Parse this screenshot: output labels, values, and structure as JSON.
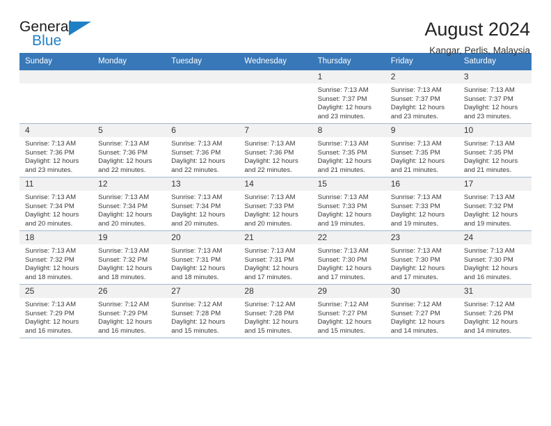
{
  "brand": {
    "name_top": "General",
    "name_bottom": "Blue",
    "flag_icon": "triangle-flag-icon"
  },
  "header": {
    "title": "August 2024",
    "location": "Kangar, Perlis, Malaysia"
  },
  "colors": {
    "header_blue": "#3878b8",
    "brand_blue": "#1f7fc4",
    "daynum_bg": "#f1f1f1",
    "grid_line": "#9fb8d0"
  },
  "weekday_headers": [
    "Sunday",
    "Monday",
    "Tuesday",
    "Wednesday",
    "Thursday",
    "Friday",
    "Saturday"
  ],
  "weeks": [
    [
      {
        "day": "",
        "blank": true
      },
      {
        "day": "",
        "blank": true
      },
      {
        "day": "",
        "blank": true
      },
      {
        "day": "",
        "blank": true
      },
      {
        "day": "1",
        "sunrise": "Sunrise: 7:13 AM",
        "sunset": "Sunset: 7:37 PM",
        "daylight_line1": "Daylight: 12 hours",
        "daylight_line2": "and 23 minutes."
      },
      {
        "day": "2",
        "sunrise": "Sunrise: 7:13 AM",
        "sunset": "Sunset: 7:37 PM",
        "daylight_line1": "Daylight: 12 hours",
        "daylight_line2": "and 23 minutes."
      },
      {
        "day": "3",
        "sunrise": "Sunrise: 7:13 AM",
        "sunset": "Sunset: 7:37 PM",
        "daylight_line1": "Daylight: 12 hours",
        "daylight_line2": "and 23 minutes."
      }
    ],
    [
      {
        "day": "4",
        "sunrise": "Sunrise: 7:13 AM",
        "sunset": "Sunset: 7:36 PM",
        "daylight_line1": "Daylight: 12 hours",
        "daylight_line2": "and 23 minutes."
      },
      {
        "day": "5",
        "sunrise": "Sunrise: 7:13 AM",
        "sunset": "Sunset: 7:36 PM",
        "daylight_line1": "Daylight: 12 hours",
        "daylight_line2": "and 22 minutes."
      },
      {
        "day": "6",
        "sunrise": "Sunrise: 7:13 AM",
        "sunset": "Sunset: 7:36 PM",
        "daylight_line1": "Daylight: 12 hours",
        "daylight_line2": "and 22 minutes."
      },
      {
        "day": "7",
        "sunrise": "Sunrise: 7:13 AM",
        "sunset": "Sunset: 7:36 PM",
        "daylight_line1": "Daylight: 12 hours",
        "daylight_line2": "and 22 minutes."
      },
      {
        "day": "8",
        "sunrise": "Sunrise: 7:13 AM",
        "sunset": "Sunset: 7:35 PM",
        "daylight_line1": "Daylight: 12 hours",
        "daylight_line2": "and 21 minutes."
      },
      {
        "day": "9",
        "sunrise": "Sunrise: 7:13 AM",
        "sunset": "Sunset: 7:35 PM",
        "daylight_line1": "Daylight: 12 hours",
        "daylight_line2": "and 21 minutes."
      },
      {
        "day": "10",
        "sunrise": "Sunrise: 7:13 AM",
        "sunset": "Sunset: 7:35 PM",
        "daylight_line1": "Daylight: 12 hours",
        "daylight_line2": "and 21 minutes."
      }
    ],
    [
      {
        "day": "11",
        "sunrise": "Sunrise: 7:13 AM",
        "sunset": "Sunset: 7:34 PM",
        "daylight_line1": "Daylight: 12 hours",
        "daylight_line2": "and 20 minutes."
      },
      {
        "day": "12",
        "sunrise": "Sunrise: 7:13 AM",
        "sunset": "Sunset: 7:34 PM",
        "daylight_line1": "Daylight: 12 hours",
        "daylight_line2": "and 20 minutes."
      },
      {
        "day": "13",
        "sunrise": "Sunrise: 7:13 AM",
        "sunset": "Sunset: 7:34 PM",
        "daylight_line1": "Daylight: 12 hours",
        "daylight_line2": "and 20 minutes."
      },
      {
        "day": "14",
        "sunrise": "Sunrise: 7:13 AM",
        "sunset": "Sunset: 7:33 PM",
        "daylight_line1": "Daylight: 12 hours",
        "daylight_line2": "and 20 minutes."
      },
      {
        "day": "15",
        "sunrise": "Sunrise: 7:13 AM",
        "sunset": "Sunset: 7:33 PM",
        "daylight_line1": "Daylight: 12 hours",
        "daylight_line2": "and 19 minutes."
      },
      {
        "day": "16",
        "sunrise": "Sunrise: 7:13 AM",
        "sunset": "Sunset: 7:33 PM",
        "daylight_line1": "Daylight: 12 hours",
        "daylight_line2": "and 19 minutes."
      },
      {
        "day": "17",
        "sunrise": "Sunrise: 7:13 AM",
        "sunset": "Sunset: 7:32 PM",
        "daylight_line1": "Daylight: 12 hours",
        "daylight_line2": "and 19 minutes."
      }
    ],
    [
      {
        "day": "18",
        "sunrise": "Sunrise: 7:13 AM",
        "sunset": "Sunset: 7:32 PM",
        "daylight_line1": "Daylight: 12 hours",
        "daylight_line2": "and 18 minutes."
      },
      {
        "day": "19",
        "sunrise": "Sunrise: 7:13 AM",
        "sunset": "Sunset: 7:32 PM",
        "daylight_line1": "Daylight: 12 hours",
        "daylight_line2": "and 18 minutes."
      },
      {
        "day": "20",
        "sunrise": "Sunrise: 7:13 AM",
        "sunset": "Sunset: 7:31 PM",
        "daylight_line1": "Daylight: 12 hours",
        "daylight_line2": "and 18 minutes."
      },
      {
        "day": "21",
        "sunrise": "Sunrise: 7:13 AM",
        "sunset": "Sunset: 7:31 PM",
        "daylight_line1": "Daylight: 12 hours",
        "daylight_line2": "and 17 minutes."
      },
      {
        "day": "22",
        "sunrise": "Sunrise: 7:13 AM",
        "sunset": "Sunset: 7:30 PM",
        "daylight_line1": "Daylight: 12 hours",
        "daylight_line2": "and 17 minutes."
      },
      {
        "day": "23",
        "sunrise": "Sunrise: 7:13 AM",
        "sunset": "Sunset: 7:30 PM",
        "daylight_line1": "Daylight: 12 hours",
        "daylight_line2": "and 17 minutes."
      },
      {
        "day": "24",
        "sunrise": "Sunrise: 7:13 AM",
        "sunset": "Sunset: 7:30 PM",
        "daylight_line1": "Daylight: 12 hours",
        "daylight_line2": "and 16 minutes."
      }
    ],
    [
      {
        "day": "25",
        "sunrise": "Sunrise: 7:13 AM",
        "sunset": "Sunset: 7:29 PM",
        "daylight_line1": "Daylight: 12 hours",
        "daylight_line2": "and 16 minutes."
      },
      {
        "day": "26",
        "sunrise": "Sunrise: 7:12 AM",
        "sunset": "Sunset: 7:29 PM",
        "daylight_line1": "Daylight: 12 hours",
        "daylight_line2": "and 16 minutes."
      },
      {
        "day": "27",
        "sunrise": "Sunrise: 7:12 AM",
        "sunset": "Sunset: 7:28 PM",
        "daylight_line1": "Daylight: 12 hours",
        "daylight_line2": "and 15 minutes."
      },
      {
        "day": "28",
        "sunrise": "Sunrise: 7:12 AM",
        "sunset": "Sunset: 7:28 PM",
        "daylight_line1": "Daylight: 12 hours",
        "daylight_line2": "and 15 minutes."
      },
      {
        "day": "29",
        "sunrise": "Sunrise: 7:12 AM",
        "sunset": "Sunset: 7:27 PM",
        "daylight_line1": "Daylight: 12 hours",
        "daylight_line2": "and 15 minutes."
      },
      {
        "day": "30",
        "sunrise": "Sunrise: 7:12 AM",
        "sunset": "Sunset: 7:27 PM",
        "daylight_line1": "Daylight: 12 hours",
        "daylight_line2": "and 14 minutes."
      },
      {
        "day": "31",
        "sunrise": "Sunrise: 7:12 AM",
        "sunset": "Sunset: 7:26 PM",
        "daylight_line1": "Daylight: 12 hours",
        "daylight_line2": "and 14 minutes."
      }
    ]
  ]
}
